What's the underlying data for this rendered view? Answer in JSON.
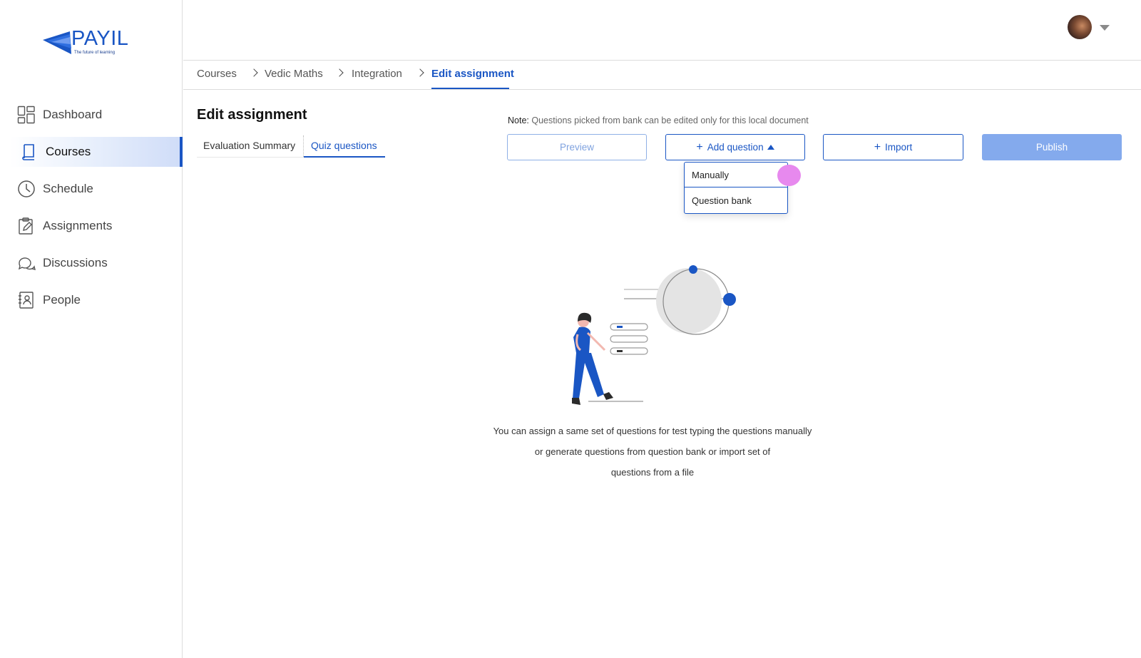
{
  "brand": {
    "name": "PAYIL",
    "tagline": "The future of learning"
  },
  "sidebar": {
    "items": [
      {
        "label": "Dashboard",
        "icon": "dashboard-icon",
        "active": false
      },
      {
        "label": "Courses",
        "icon": "book-icon",
        "active": true
      },
      {
        "label": "Schedule",
        "icon": "clock-icon",
        "active": false
      },
      {
        "label": "Assignments",
        "icon": "clipboard-edit-icon",
        "active": false
      },
      {
        "label": "Discussions",
        "icon": "chat-bubbles-icon",
        "active": false
      },
      {
        "label": "People",
        "icon": "contact-book-icon",
        "active": false
      }
    ]
  },
  "breadcrumb": [
    "Courses",
    "Vedic Maths",
    "Integration",
    "Edit assignment"
  ],
  "page": {
    "title": "Edit assignment",
    "tabs": [
      {
        "label": "Evaluation Summary",
        "active": false
      },
      {
        "label": "Quiz questions",
        "active": true
      }
    ],
    "note_label": "Note:",
    "note_text": "Questions picked from bank can be edited only for this local document"
  },
  "actions": {
    "preview": "Preview",
    "add_question": "Add question",
    "import": "Import",
    "publish": "Publish"
  },
  "add_question_menu": [
    "Manually",
    "Question bank"
  ],
  "empty_state": {
    "line1": "You can assign a same set of questions for test typing the questions manually",
    "line2": "or generate questions from question bank or import set of",
    "line3": "questions from a file"
  },
  "colors": {
    "accent": "#1a56c4",
    "publish_disabled": "#84aaed",
    "cursor": "#e789ee"
  }
}
